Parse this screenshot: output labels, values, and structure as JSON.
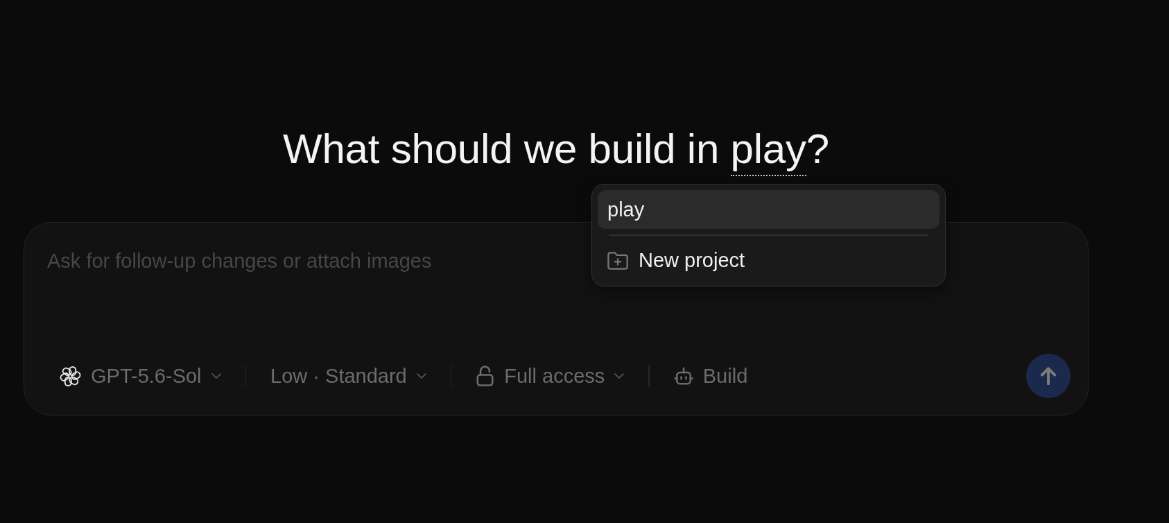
{
  "heading": {
    "text_before": "What should we build in ",
    "project": "play",
    "text_after": "?"
  },
  "project_menu": {
    "items": [
      {
        "kind": "project",
        "label": "play",
        "selected": true
      },
      {
        "kind": "new",
        "label": "New project",
        "selected": false
      }
    ]
  },
  "composer": {
    "placeholder": "Ask for follow-up changes or attach images",
    "controls": [
      {
        "kind": "model",
        "label": "GPT-5.6-Sol",
        "dropdown": true
      },
      {
        "kind": "effort",
        "label": "Low · Standard",
        "dropdown": true
      },
      {
        "kind": "access",
        "label": "Full access",
        "dropdown": true
      },
      {
        "kind": "mode",
        "label": "Build",
        "dropdown": false
      }
    ],
    "send_button": {
      "disabled": true
    }
  }
}
